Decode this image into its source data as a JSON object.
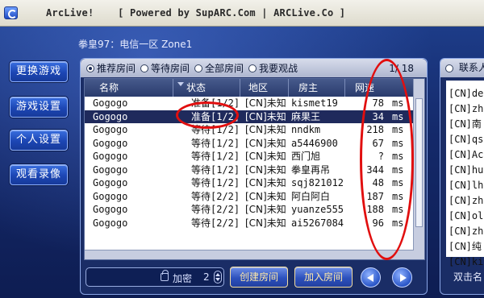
{
  "window": {
    "title": "ArcLive!    [ Powered by SupARC.Com | ARCLive.Co ]"
  },
  "header": {
    "game_line": "拳皇97：电信一区 Zone1"
  },
  "nav": {
    "items": [
      {
        "label": "更换游戏"
      },
      {
        "label": "游戏设置"
      },
      {
        "label": "个人设置"
      },
      {
        "label": "观看录像"
      }
    ]
  },
  "room_panel": {
    "tabs": [
      {
        "label": "推荐房间",
        "selected": true
      },
      {
        "label": "等待房间",
        "selected": false
      },
      {
        "label": "全部房间",
        "selected": false
      },
      {
        "label": "我要观战",
        "selected": false
      }
    ],
    "page": "1/ 18",
    "columns": [
      "名称",
      "状态",
      "地区",
      "房主",
      "网速"
    ],
    "rows": [
      {
        "name": "Gogogo",
        "status": "准备[1/2]",
        "region": "[CN]未知",
        "host": "kismet19",
        "speed": "78",
        "unit": "ms"
      },
      {
        "name": "Gogogo",
        "status": "准备[1/2]",
        "region": "[CN]未知",
        "host": "麻果王",
        "speed": "34",
        "unit": "ms"
      },
      {
        "name": "Gogogo",
        "status": "等待[1/2]",
        "region": "[CN]未知",
        "host": "nndkm",
        "speed": "218",
        "unit": "ms"
      },
      {
        "name": "Gogogo",
        "status": "等待[1/2]",
        "region": "[CN]未知",
        "host": "a5446900",
        "speed": "67",
        "unit": "ms"
      },
      {
        "name": "Gogogo",
        "status": "等待[1/2]",
        "region": "[CN]未知",
        "host": "西门旭",
        "speed": "?",
        "unit": "ms"
      },
      {
        "name": "Gogogo",
        "status": "等待[1/2]",
        "region": "[CN]未知",
        "host": "拳皇再吊",
        "speed": "344",
        "unit": "ms"
      },
      {
        "name": "Gogogo",
        "status": "等待[1/2]",
        "region": "[CN]未知",
        "host": "sqj821012",
        "speed": "48",
        "unit": "ms"
      },
      {
        "name": "Gogogo",
        "status": "等待[2/2]",
        "region": "[CN]未知",
        "host": "阿白阿白",
        "speed": "187",
        "unit": "ms"
      },
      {
        "name": "Gogogo",
        "status": "等待[2/2]",
        "region": "[CN]未知",
        "host": "yuanze555",
        "speed": "188",
        "unit": "ms"
      },
      {
        "name": "Gogogo",
        "status": "等待[2/2]",
        "region": "[CN]未知",
        "host": "ai5267084",
        "speed": "96",
        "unit": "ms"
      }
    ],
    "password": {
      "label": "加密",
      "value": "2"
    },
    "buttons": {
      "create": "创建房间",
      "join": "加入房间"
    }
  },
  "contact_panel": {
    "title": "联系人",
    "items": [
      "[CN]de",
      "[CN]zh",
      "[CN]南",
      "[CN]qs",
      "[CN]Ac",
      "[CN]hu",
      "[CN]lh",
      "[CN]zh",
      "[CN]ol",
      "[CN]zh",
      "[CN]纯",
      "[CN]ki"
    ],
    "footer": "双击名"
  },
  "colors": {
    "highlight": "#e10f0f",
    "selected_row": "#1f2a5c",
    "button_text": "#ffe9a8"
  }
}
